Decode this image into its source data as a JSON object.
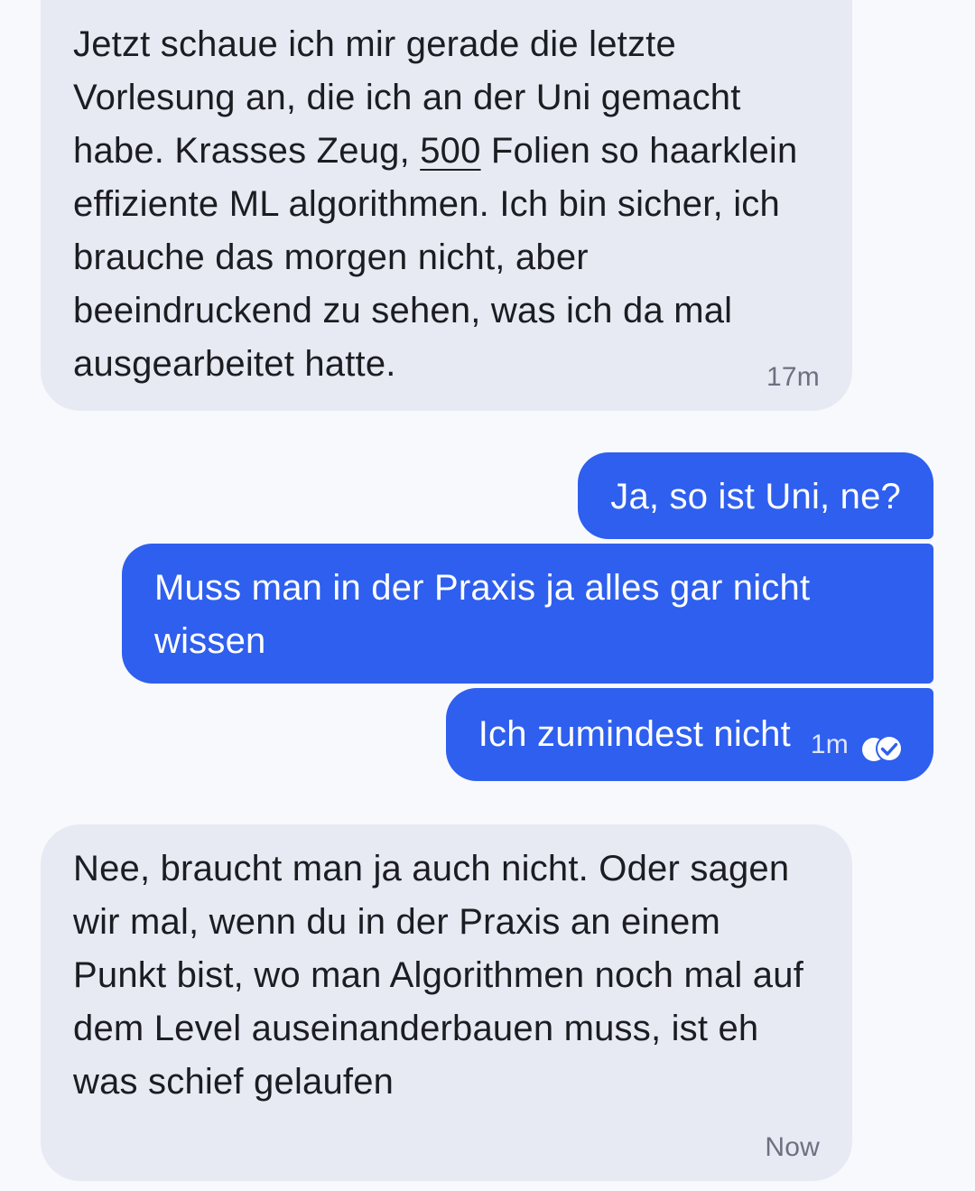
{
  "messages": [
    {
      "direction": "incoming",
      "text_before": "Jetzt schaue ich mir gerade die letzte Vorlesung an, die ich an der Uni gemacht habe. Krasses Zeug, ",
      "link_number": "500",
      "text_after": " Folien so haarklein effiziente ML algorithmen. Ich bin sicher, ich brauche das morgen nicht, aber beeindruckend zu sehen, was ich da mal ausgearbeitet hatte.",
      "timestamp": "17m"
    },
    {
      "direction": "outgoing",
      "text": "Ja, so ist Uni, ne?"
    },
    {
      "direction": "outgoing",
      "text": "Muss man in der Praxis ja alles gar nicht wissen"
    },
    {
      "direction": "outgoing",
      "text": "Ich zumindest nicht",
      "timestamp": "1m",
      "status_icon": "read-receipt-icon"
    },
    {
      "direction": "incoming",
      "text": "Nee, braucht man ja auch nicht. Oder sagen wir mal, wenn du in der Praxis an einem Punkt bist, wo man Algorithmen noch mal auf dem Level auseinanderbauen muss, ist eh was schief gelaufen",
      "timestamp": "Now"
    }
  ],
  "colors": {
    "background": "#f8f9fd",
    "incoming_bubble": "#e7eaf3",
    "outgoing_bubble": "#2e5fee",
    "incoming_text": "#1c1d22",
    "outgoing_text": "#ffffff",
    "timestamp_incoming": "#6c7080"
  }
}
